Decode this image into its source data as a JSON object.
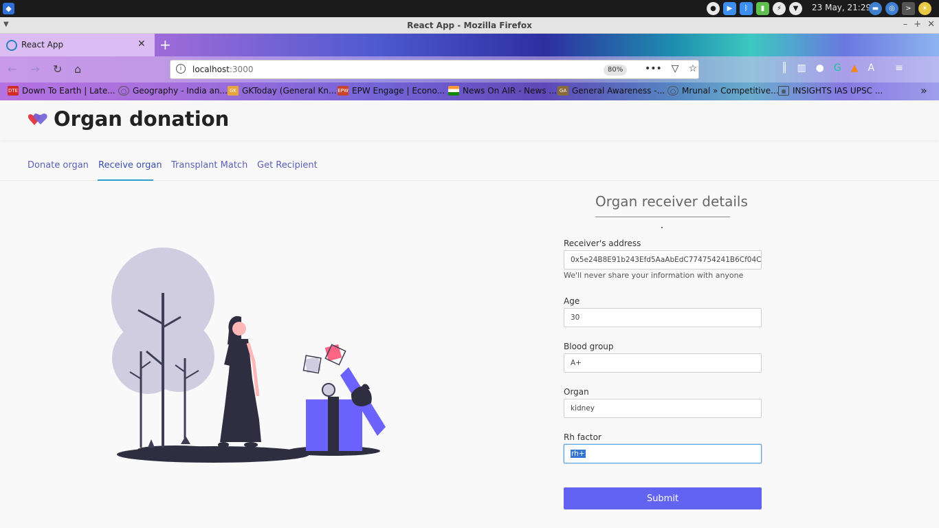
{
  "system": {
    "clock": "23 May, 21:29"
  },
  "window": {
    "title": "React App - Mozilla Firefox"
  },
  "browser": {
    "tab_title": "React App",
    "url_host": "localhost",
    "url_port": ":3000",
    "zoom": "80%",
    "bookmarks": [
      {
        "label": "Down To Earth | Late...",
        "icon": "DTE",
        "color": "#d42a2a"
      },
      {
        "label": "Geography - India an...",
        "icon": "globe-icon",
        "color": "#666666"
      },
      {
        "label": "GKToday (General Kn...",
        "icon": "gk-icon",
        "color": "#e8a33a"
      },
      {
        "label": "EPW Engage | Econo...",
        "icon": "EPW",
        "color": "#c8452a"
      },
      {
        "label": "News On AIR - News ...",
        "icon": "india-flag-icon",
        "color": "#ff9933"
      },
      {
        "label": "General Awareness -...",
        "icon": "ga-icon",
        "color": "#8a6a3a"
      },
      {
        "label": "Mrunal » Competitive...",
        "icon": "globe-icon",
        "color": "#666666"
      },
      {
        "label": "INSIGHTS IAS UPSC ...",
        "icon": "grid-icon",
        "color": "#444444"
      }
    ]
  },
  "app": {
    "title": "Organ donation",
    "tabs": [
      {
        "label": "Donate organ"
      },
      {
        "label": "Receive organ"
      },
      {
        "label": "Transplant Match"
      },
      {
        "label": "Get Recipient"
      }
    ],
    "form": {
      "title": "Organ receiver details",
      "address_label": "Receiver's address",
      "address_value": "0x5e24B8E91b243Efd5AaAbEdC774754241B6Cf04C",
      "address_help": "We'll never share your information with anyone",
      "age_label": "Age",
      "age_value": "30",
      "blood_label": "Blood group",
      "blood_value": "A+",
      "organ_label": "Organ",
      "organ_value": "kidney",
      "rh_label": "Rh factor",
      "rh_value": "rh+",
      "submit_label": "Submit"
    }
  },
  "colors": {
    "accent": "#6363f2",
    "tab_active_underline": "#2f9fc7",
    "tab_text": "#5a5fb8"
  }
}
